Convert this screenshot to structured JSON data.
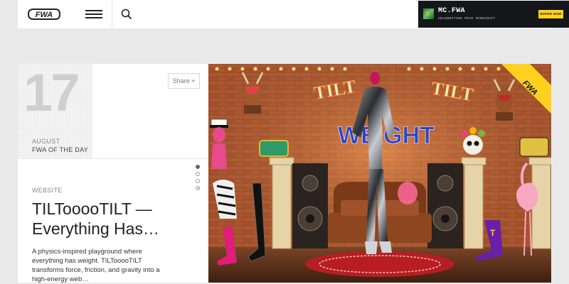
{
  "header": {
    "logo_text": "FWA",
    "promo": {
      "title": "MC.FWA",
      "subtitle": "CELEBRATING PEAK MINECRAFT",
      "button": "ENTER NOW"
    }
  },
  "card": {
    "day": "17",
    "month": "AUGUST",
    "award": "FWA OF THE DAY",
    "share_label": "Share +",
    "category": "WEBSITE",
    "title": "TILTooooTILT — Everything Has…",
    "description": "A physics-inspired playground where everything has weight. TILTooooTILT transforms force, friction, and gravity into a high-energy web…",
    "hero_signs": [
      "TILT",
      "TILT",
      "WEIGHT"
    ],
    "badge_text": "FWA"
  },
  "colors": {
    "accent": "#ffd11f",
    "promo_bg": "#14161a",
    "page_bg": "#e9e9e9"
  }
}
